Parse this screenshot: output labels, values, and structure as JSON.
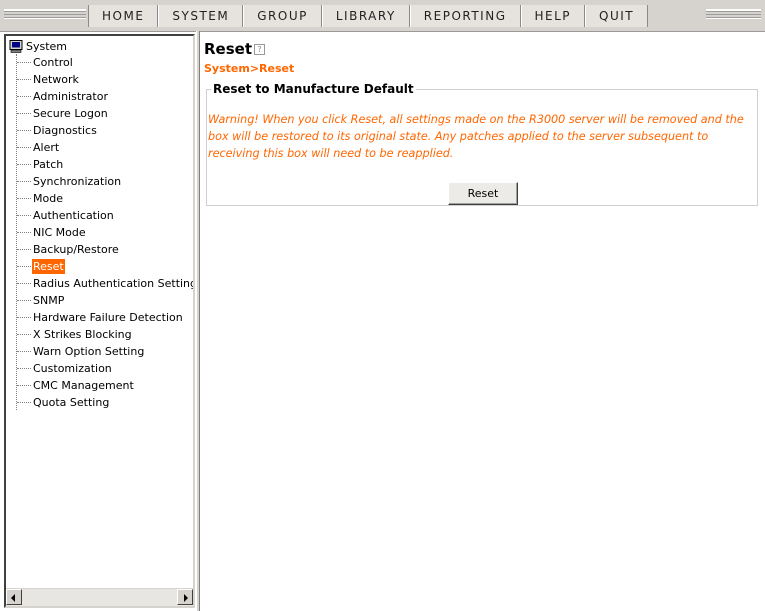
{
  "nav": {
    "items": [
      "HOME",
      "SYSTEM",
      "GROUP",
      "LIBRARY",
      "REPORTING",
      "HELP",
      "QUIT"
    ]
  },
  "sidebar": {
    "root_label": "System",
    "items": [
      {
        "label": "Control"
      },
      {
        "label": "Network"
      },
      {
        "label": "Administrator"
      },
      {
        "label": "Secure Logon"
      },
      {
        "label": "Diagnostics"
      },
      {
        "label": "Alert"
      },
      {
        "label": "Patch"
      },
      {
        "label": "Synchronization"
      },
      {
        "label": "Mode"
      },
      {
        "label": "Authentication"
      },
      {
        "label": "NIC Mode"
      },
      {
        "label": "Backup/Restore"
      },
      {
        "label": "Reset",
        "selected": true
      },
      {
        "label": "Radius Authentication Setting"
      },
      {
        "label": "SNMP"
      },
      {
        "label": "Hardware Failure Detection"
      },
      {
        "label": "X Strikes Blocking"
      },
      {
        "label": "Warn Option Setting"
      },
      {
        "label": "Customization"
      },
      {
        "label": "CMC Management"
      },
      {
        "label": "Quota Setting"
      }
    ]
  },
  "main": {
    "title": "Reset",
    "breadcrumb": "System>Reset",
    "panel": {
      "legend": "Reset to Manufacture Default",
      "warning": "Warning! When you click Reset, all settings made on the R3000 server will be removed and the box will be restored to its original state. Any patches applied to the server subsequent to receiving this box will need to be reapplied.",
      "button_label": "Reset"
    }
  },
  "colors": {
    "accent": "#ff6600",
    "chrome": "#d6d3ce",
    "selected_bg": "#ff6600"
  },
  "icons": {
    "root": "computer-icon",
    "title_help": "help-icon",
    "scroll_left": "arrow-left-icon",
    "scroll_right": "arrow-right-icon"
  }
}
